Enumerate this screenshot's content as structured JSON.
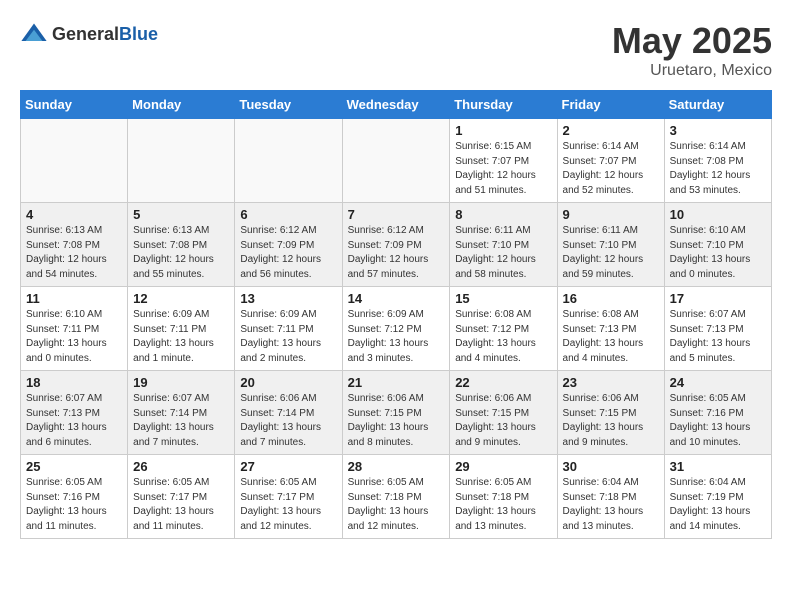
{
  "logo": {
    "general": "General",
    "blue": "Blue"
  },
  "title": {
    "month_year": "May 2025",
    "location": "Uruetaro, Mexico"
  },
  "weekdays": [
    "Sunday",
    "Monday",
    "Tuesday",
    "Wednesday",
    "Thursday",
    "Friday",
    "Saturday"
  ],
  "weeks": [
    [
      {
        "day": "",
        "info": ""
      },
      {
        "day": "",
        "info": ""
      },
      {
        "day": "",
        "info": ""
      },
      {
        "day": "",
        "info": ""
      },
      {
        "day": "1",
        "info": "Sunrise: 6:15 AM\nSunset: 7:07 PM\nDaylight: 12 hours\nand 51 minutes."
      },
      {
        "day": "2",
        "info": "Sunrise: 6:14 AM\nSunset: 7:07 PM\nDaylight: 12 hours\nand 52 minutes."
      },
      {
        "day": "3",
        "info": "Sunrise: 6:14 AM\nSunset: 7:08 PM\nDaylight: 12 hours\nand 53 minutes."
      }
    ],
    [
      {
        "day": "4",
        "info": "Sunrise: 6:13 AM\nSunset: 7:08 PM\nDaylight: 12 hours\nand 54 minutes."
      },
      {
        "day": "5",
        "info": "Sunrise: 6:13 AM\nSunset: 7:08 PM\nDaylight: 12 hours\nand 55 minutes."
      },
      {
        "day": "6",
        "info": "Sunrise: 6:12 AM\nSunset: 7:09 PM\nDaylight: 12 hours\nand 56 minutes."
      },
      {
        "day": "7",
        "info": "Sunrise: 6:12 AM\nSunset: 7:09 PM\nDaylight: 12 hours\nand 57 minutes."
      },
      {
        "day": "8",
        "info": "Sunrise: 6:11 AM\nSunset: 7:10 PM\nDaylight: 12 hours\nand 58 minutes."
      },
      {
        "day": "9",
        "info": "Sunrise: 6:11 AM\nSunset: 7:10 PM\nDaylight: 12 hours\nand 59 minutes."
      },
      {
        "day": "10",
        "info": "Sunrise: 6:10 AM\nSunset: 7:10 PM\nDaylight: 13 hours\nand 0 minutes."
      }
    ],
    [
      {
        "day": "11",
        "info": "Sunrise: 6:10 AM\nSunset: 7:11 PM\nDaylight: 13 hours\nand 0 minutes."
      },
      {
        "day": "12",
        "info": "Sunrise: 6:09 AM\nSunset: 7:11 PM\nDaylight: 13 hours\nand 1 minute."
      },
      {
        "day": "13",
        "info": "Sunrise: 6:09 AM\nSunset: 7:11 PM\nDaylight: 13 hours\nand 2 minutes."
      },
      {
        "day": "14",
        "info": "Sunrise: 6:09 AM\nSunset: 7:12 PM\nDaylight: 13 hours\nand 3 minutes."
      },
      {
        "day": "15",
        "info": "Sunrise: 6:08 AM\nSunset: 7:12 PM\nDaylight: 13 hours\nand 4 minutes."
      },
      {
        "day": "16",
        "info": "Sunrise: 6:08 AM\nSunset: 7:13 PM\nDaylight: 13 hours\nand 4 minutes."
      },
      {
        "day": "17",
        "info": "Sunrise: 6:07 AM\nSunset: 7:13 PM\nDaylight: 13 hours\nand 5 minutes."
      }
    ],
    [
      {
        "day": "18",
        "info": "Sunrise: 6:07 AM\nSunset: 7:13 PM\nDaylight: 13 hours\nand 6 minutes."
      },
      {
        "day": "19",
        "info": "Sunrise: 6:07 AM\nSunset: 7:14 PM\nDaylight: 13 hours\nand 7 minutes."
      },
      {
        "day": "20",
        "info": "Sunrise: 6:06 AM\nSunset: 7:14 PM\nDaylight: 13 hours\nand 7 minutes."
      },
      {
        "day": "21",
        "info": "Sunrise: 6:06 AM\nSunset: 7:15 PM\nDaylight: 13 hours\nand 8 minutes."
      },
      {
        "day": "22",
        "info": "Sunrise: 6:06 AM\nSunset: 7:15 PM\nDaylight: 13 hours\nand 9 minutes."
      },
      {
        "day": "23",
        "info": "Sunrise: 6:06 AM\nSunset: 7:15 PM\nDaylight: 13 hours\nand 9 minutes."
      },
      {
        "day": "24",
        "info": "Sunrise: 6:05 AM\nSunset: 7:16 PM\nDaylight: 13 hours\nand 10 minutes."
      }
    ],
    [
      {
        "day": "25",
        "info": "Sunrise: 6:05 AM\nSunset: 7:16 PM\nDaylight: 13 hours\nand 11 minutes."
      },
      {
        "day": "26",
        "info": "Sunrise: 6:05 AM\nSunset: 7:17 PM\nDaylight: 13 hours\nand 11 minutes."
      },
      {
        "day": "27",
        "info": "Sunrise: 6:05 AM\nSunset: 7:17 PM\nDaylight: 13 hours\nand 12 minutes."
      },
      {
        "day": "28",
        "info": "Sunrise: 6:05 AM\nSunset: 7:18 PM\nDaylight: 13 hours\nand 12 minutes."
      },
      {
        "day": "29",
        "info": "Sunrise: 6:05 AM\nSunset: 7:18 PM\nDaylight: 13 hours\nand 13 minutes."
      },
      {
        "day": "30",
        "info": "Sunrise: 6:04 AM\nSunset: 7:18 PM\nDaylight: 13 hours\nand 13 minutes."
      },
      {
        "day": "31",
        "info": "Sunrise: 6:04 AM\nSunset: 7:19 PM\nDaylight: 13 hours\nand 14 minutes."
      }
    ]
  ]
}
